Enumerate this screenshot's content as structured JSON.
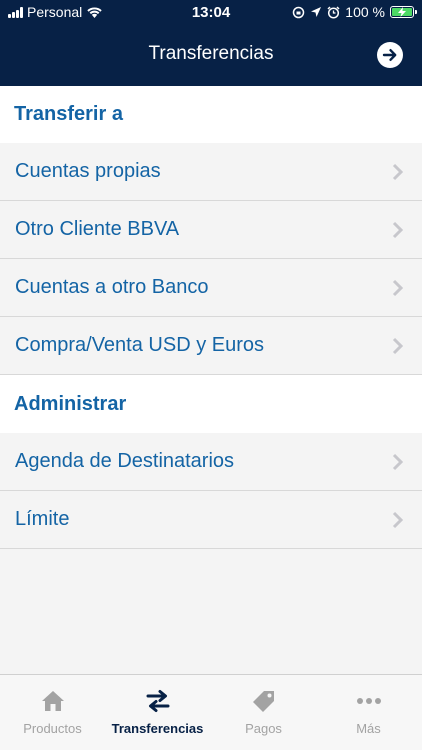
{
  "status_bar": {
    "carrier": "Personal",
    "time": "13:04",
    "battery": "100 %"
  },
  "nav": {
    "title": "Transferencias"
  },
  "sections": [
    {
      "title": "Transferir a",
      "items": [
        {
          "label": "Cuentas propias"
        },
        {
          "label": "Otro Cliente BBVA"
        },
        {
          "label": "Cuentas a otro Banco"
        },
        {
          "label": "Compra/Venta USD y Euros"
        }
      ]
    },
    {
      "title": "Administrar",
      "items": [
        {
          "label": "Agenda de Destinatarios"
        },
        {
          "label": "Límite"
        }
      ]
    }
  ],
  "tabbar": {
    "tabs": [
      {
        "label": "Productos",
        "icon": "home-icon"
      },
      {
        "label": "Transferencias",
        "icon": "transfer-arrows-icon",
        "active": true
      },
      {
        "label": "Pagos",
        "icon": "tag-icon"
      },
      {
        "label": "Más",
        "icon": "more-dots-icon"
      }
    ]
  },
  "colors": {
    "header_bg": "#072146",
    "accent": "#1464a5",
    "tab_inactive": "#a3a3a3"
  }
}
